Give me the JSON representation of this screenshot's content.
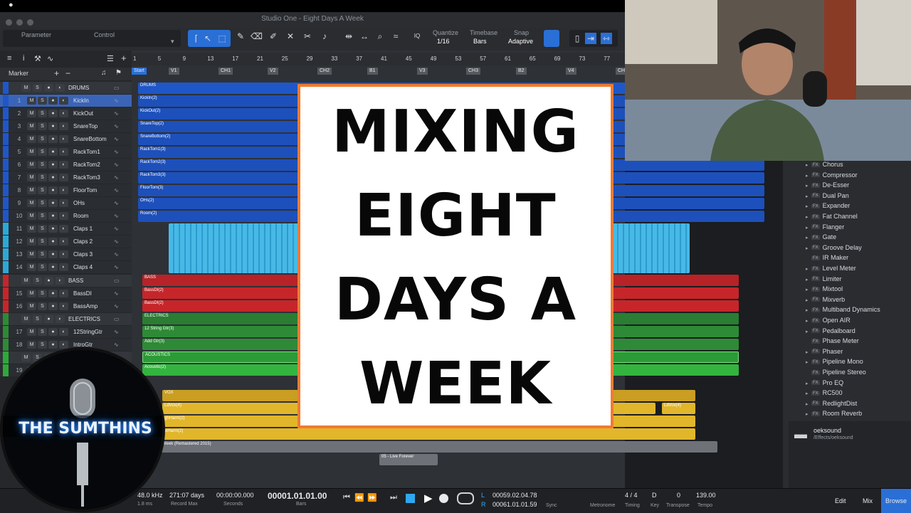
{
  "window": {
    "title": "Studio One - Eight Days A Week"
  },
  "toolbar": {
    "parameter_label": "Parameter",
    "control_label": "Control",
    "quantize_label": "Quantize",
    "quantize_value": "1/16",
    "timebase_label": "Timebase",
    "timebase_value": "Bars",
    "snap_label": "Snap",
    "snap_value": "Adaptive"
  },
  "track_panel": {
    "marker_label": "Marker"
  },
  "ruler": [
    "1",
    "5",
    "9",
    "13",
    "17",
    "21",
    "25",
    "29",
    "33",
    "37",
    "41",
    "45",
    "49",
    "53",
    "57",
    "61",
    "65",
    "69",
    "73",
    "77"
  ],
  "markers": [
    "Start",
    "V1",
    "CH1",
    "V2",
    "CH2",
    "B1",
    "V3",
    "CH3",
    "B2",
    "V4",
    "CH"
  ],
  "tracks": [
    {
      "num": "",
      "name": "DRUMS",
      "folder": true,
      "color": "#1f57c8"
    },
    {
      "num": "1",
      "name": "KickIn",
      "color": "#1f57c8"
    },
    {
      "num": "2",
      "name": "KickOut",
      "color": "#1f57c8"
    },
    {
      "num": "3",
      "name": "SnareTop",
      "color": "#1f57c8"
    },
    {
      "num": "4",
      "name": "SnareBottom",
      "color": "#1f57c8"
    },
    {
      "num": "5",
      "name": "RackTom1",
      "color": "#1f57c8"
    },
    {
      "num": "6",
      "name": "RackTom2",
      "color": "#1f57c8"
    },
    {
      "num": "7",
      "name": "RackTom3",
      "color": "#1f57c8"
    },
    {
      "num": "8",
      "name": "FloorTom",
      "color": "#1f57c8"
    },
    {
      "num": "9",
      "name": "OHs",
      "color": "#1f57c8"
    },
    {
      "num": "10",
      "name": "Room",
      "color": "#1f57c8"
    },
    {
      "num": "11",
      "name": "Claps 1",
      "color": "#2ba9d6"
    },
    {
      "num": "12",
      "name": "Claps 2",
      "color": "#2ba9d6"
    },
    {
      "num": "13",
      "name": "Claps 3",
      "color": "#2ba9d6"
    },
    {
      "num": "14",
      "name": "Claps 4",
      "color": "#2ba9d6"
    },
    {
      "num": "",
      "name": "BASS",
      "folder": true,
      "color": "#c6262a"
    },
    {
      "num": "15",
      "name": "BassDI",
      "color": "#c6262a"
    },
    {
      "num": "16",
      "name": "BassAmp",
      "color": "#c6262a"
    },
    {
      "num": "",
      "name": "ELECTRICS",
      "folder": true,
      "color": "#2e8a36"
    },
    {
      "num": "17",
      "name": "12StringGtr",
      "color": "#2e8a36"
    },
    {
      "num": "18",
      "name": "IntroGtr",
      "color": "#2e8a36"
    },
    {
      "num": "",
      "name": "",
      "folder": true,
      "color": "#2fa83a"
    },
    {
      "num": "19",
      "name": "",
      "color": "#2fa83a"
    }
  ],
  "clips": {
    "drums_folder": "DRUMS",
    "kickin": "KickIn(2)",
    "kickout": "KickOut(2)",
    "snaretop": "SnareTop(2)",
    "snarebottom": "SnareBottom(2)",
    "racktom1": "RackTom1(3)",
    "racktom2": "RackTom2(3)",
    "racktom3": "RackTom3(3)",
    "floortom": "FloorTom(3)",
    "ohs": "OHs(2)",
    "room": "Room(2)",
    "bass_folder": "BASS",
    "bassdi": "BassDI(2)",
    "bassamp": "BassDI(2)",
    "electrics_folder": "ELECTRICS",
    "gtr12": "12 String Gtr(3)",
    "addgtr": "Add Gtr(3)",
    "acoustics_folder": "ACOUSTICS",
    "acoustic": "Acoustic(2)",
    "vox_folder": "VOX",
    "leadvox": "LdVox(4)",
    "leadvox2": "LdVox(4)",
    "harm1": "ghHarm(2)",
    "harm2": "wHarm(2)",
    "reference": "Week (Remastered 2015)",
    "live": "05 - Live Forever"
  },
  "browser": {
    "items": [
      {
        "name": "Chorus",
        "arrow": true
      },
      {
        "name": "Compressor",
        "arrow": true
      },
      {
        "name": "De-Esser",
        "arrow": true
      },
      {
        "name": "Dual Pan",
        "arrow": true
      },
      {
        "name": "Expander",
        "arrow": true
      },
      {
        "name": "Fat Channel",
        "arrow": true
      },
      {
        "name": "Flanger",
        "arrow": true
      },
      {
        "name": "Gate",
        "arrow": true
      },
      {
        "name": "Groove Delay",
        "arrow": true
      },
      {
        "name": "IR Maker",
        "arrow": false
      },
      {
        "name": "Level Meter",
        "arrow": true
      },
      {
        "name": "Limiter",
        "arrow": true
      },
      {
        "name": "Mixtool",
        "arrow": true
      },
      {
        "name": "Mixverb",
        "arrow": true
      },
      {
        "name": "Multiband Dynamics",
        "arrow": true
      },
      {
        "name": "Open AIR",
        "arrow": true
      },
      {
        "name": "Pedalboard",
        "arrow": true
      },
      {
        "name": "Phase Meter",
        "arrow": false
      },
      {
        "name": "Phaser",
        "arrow": true
      },
      {
        "name": "Pipeline Mono",
        "arrow": true
      },
      {
        "name": "Pipeline Stereo",
        "arrow": false
      },
      {
        "name": "Pro EQ",
        "arrow": true
      },
      {
        "name": "RC500",
        "arrow": true
      },
      {
        "name": "RedlightDist",
        "arrow": true
      },
      {
        "name": "Room Reverb",
        "arrow": true
      }
    ],
    "tag": "FX",
    "folder_name": "oeksound",
    "folder_path": "/Effects/oeksound"
  },
  "transport": {
    "sample_rate": "48.0 kHz",
    "latency": "1.8 ms",
    "record_max_value": "271:07 days",
    "record_max_label": "Record Max",
    "seconds_value": "00:00:00.000",
    "seconds_label": "Seconds",
    "bars_value": "00001.01.01.00",
    "bars_label": "Bars",
    "loop_l": "L",
    "loop_r": "R",
    "loop_start": "00059.02.04.78",
    "loop_end": "00061.01.01.59",
    "sync_label": "Sync",
    "metronome_label": "Metronome",
    "timing_value": "4 / 4",
    "timing_label": "Timing",
    "key_value": "D",
    "key_label": "Key",
    "transpose_value": "0",
    "transpose_label": "Transpose",
    "tempo_value": "139.00",
    "tempo_label": "Tempo",
    "edit_label": "Edit",
    "mix_label": "Mix",
    "browse_label": "Browse"
  },
  "overlay": {
    "title_lines": [
      "MIXING",
      "EIGHT",
      "DAYS A",
      "WEEK"
    ],
    "logo_text": "THE SUMTHINS",
    "card_border": "#f07a32"
  },
  "colors": {
    "drums": "#1f57c8",
    "claps": "#2ba9d6",
    "bass": "#c6262a",
    "electrics": "#2e8a36",
    "acoustics": "#2fa83a",
    "vox": "#e2b62a",
    "accent": "#2a6fd6"
  }
}
